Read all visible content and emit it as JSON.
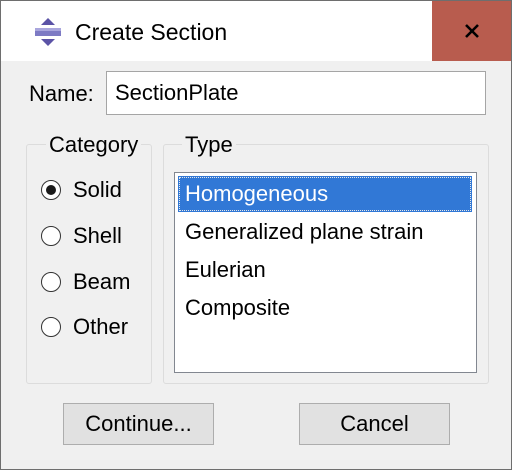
{
  "window": {
    "title": "Create Section",
    "icon": "abaqus-section-icon",
    "close_icon": "close-x-icon"
  },
  "name": {
    "label": "Name:",
    "value": "SectionPlate"
  },
  "category": {
    "title": "Category",
    "options": [
      "Solid",
      "Shell",
      "Beam",
      "Other"
    ],
    "selected": "Solid"
  },
  "type": {
    "title": "Type",
    "items": [
      "Homogeneous",
      "Generalized plane strain",
      "Eulerian",
      "Composite"
    ],
    "selected": "Homogeneous"
  },
  "buttons": {
    "continue_label": "Continue...",
    "cancel_label": "Cancel"
  },
  "colors": {
    "close_button": "#b85c4e",
    "selection": "#3178d6",
    "dialog_background": "#f0f0f0"
  }
}
